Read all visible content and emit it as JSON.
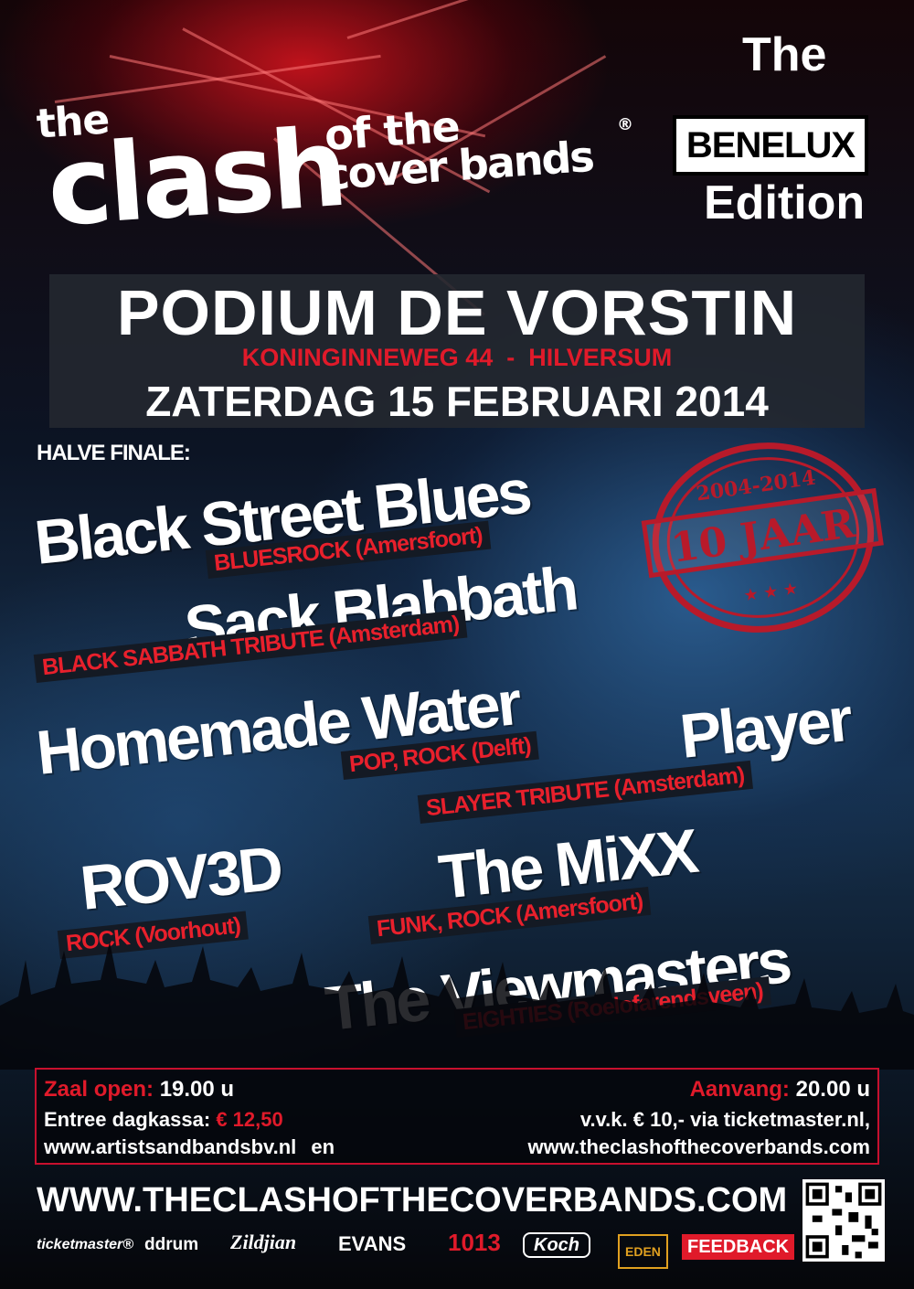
{
  "logo": {
    "the": "the",
    "clash": "clash",
    "of_the": "of the",
    "cover_bands": "cover bands",
    "registered": "®"
  },
  "edition": {
    "the": "The",
    "benelux": "BENELUX",
    "edition": "Edition"
  },
  "venue": {
    "name": "PODIUM DE VORSTIN",
    "address": "KONINGINNEWEG 44  -  HILVERSUM",
    "date": "ZATERDAG 15 FEBRUARI 2014"
  },
  "section_label": "HALVE FINALE:",
  "stamp": {
    "years": "2004-2014",
    "label": "10 JAAR"
  },
  "bands": [
    {
      "name": "Black Street Blues",
      "genre": "BLUESROCK (Amersfoort)"
    },
    {
      "name": "Sack Blabbath",
      "genre": "BLACK SABBATH TRIBUTE (Amsterdam)"
    },
    {
      "name": "Homemade Water",
      "genre": "POP, ROCK (Delft)"
    },
    {
      "name": "Player",
      "genre": "SLAYER TRIBUTE (Amsterdam)"
    },
    {
      "name": "ROV3D",
      "genre": "ROCK (Voorhout)"
    },
    {
      "name": "The MiXX",
      "genre": "FUNK, ROCK (Amersfoort)"
    },
    {
      "name": "The Viewmasters",
      "genre": "EIGHTIES (Roelofarendsveen)"
    }
  ],
  "info": {
    "doors_label": "Zaal open:",
    "doors_time": "19.00 u",
    "start_label": "Aanvang:",
    "start_time": "20.00 u",
    "entry_label": "Entree dagkassa:",
    "entry_price": "€ 12,50",
    "presale": "v.v.k. € 10,- via ticketmaster.nl,",
    "site1": "www.artistsandbandsbv.nl",
    "and": "en",
    "site2": "www.theclashofthecoverbands.com"
  },
  "website": "WWW.THECLASHOFTHECOVERBANDS.COM",
  "sponsors": [
    "ticketmaster®",
    "ddrum",
    "Zildjian",
    "EVANS",
    "1013",
    "Koch",
    "EDEN",
    "FEEDBACK"
  ],
  "colors": {
    "accent_red": "#e01a2a",
    "panel": "#23282f",
    "background_blue": "#17324f"
  }
}
